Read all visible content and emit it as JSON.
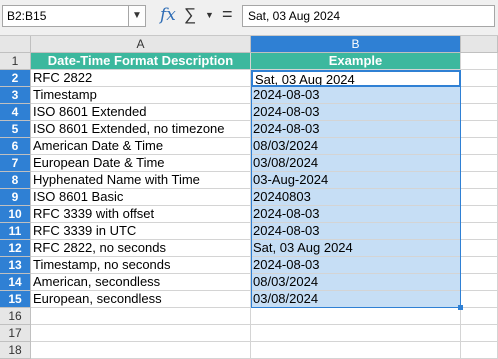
{
  "formula_bar": {
    "name_box": "B2:B15",
    "formula": "Sat, 03 Aug 2024"
  },
  "columns": [
    "A",
    "B"
  ],
  "header": {
    "a": "Date-Time Format Description",
    "b": "Example"
  },
  "rows": [
    {
      "num": "2",
      "a": "RFC 2822",
      "b": "Sat, 03 Aug 2024"
    },
    {
      "num": "3",
      "a": "Timestamp",
      "b": "2024-08-03"
    },
    {
      "num": "4",
      "a": "ISO 8601 Extended",
      "b": "2024-08-03"
    },
    {
      "num": "5",
      "a": "ISO 8601 Extended, no timezone",
      "b": "2024-08-03"
    },
    {
      "num": "6",
      "a": "American Date & Time",
      "b": "08/03/2024"
    },
    {
      "num": "7",
      "a": "European Date & Time",
      "b": "03/08/2024"
    },
    {
      "num": "8",
      "a": "Hyphenated Name with Time",
      "b": "03-Aug-2024"
    },
    {
      "num": "9",
      "a": "ISO 8601 Basic",
      "b": "20240803"
    },
    {
      "num": "10",
      "a": "RFC 3339 with offset",
      "b": "2024-08-03"
    },
    {
      "num": "11",
      "a": "RFC 3339 in UTC",
      "b": "2024-08-03"
    },
    {
      "num": "12",
      "a": "RFC 2822, no seconds",
      "b": "Sat, 03 Aug 2024"
    },
    {
      "num": "13",
      "a": "Timestamp, no seconds",
      "b": "2024-08-03"
    },
    {
      "num": "14",
      "a": "American, secondless",
      "b": "08/03/2024"
    },
    {
      "num": "15",
      "a": "European, secondless",
      "b": "03/08/2024"
    }
  ],
  "empty_rows": [
    "16",
    "17",
    "18"
  ],
  "header_row_num": "1",
  "colors": {
    "header_fill": "#3cb89e",
    "selection_fill": "#c6def5",
    "selection_accent": "#2f80d4"
  }
}
